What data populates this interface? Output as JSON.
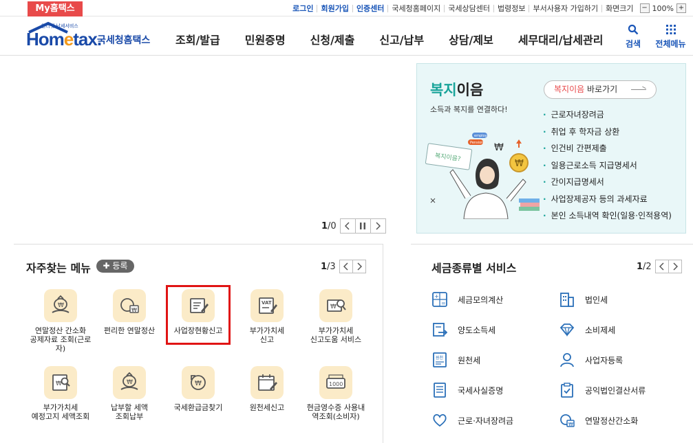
{
  "topbar": {
    "my_hometax": "My홈택스",
    "links": [
      {
        "label": "로그인",
        "blue": true
      },
      {
        "label": "회원가입",
        "blue": true
      },
      {
        "label": "인증센터",
        "blue": true
      },
      {
        "label": "국세청홈페이지",
        "blue": false
      },
      {
        "label": "국세상담센터",
        "blue": false
      },
      {
        "label": "법령정보",
        "blue": false
      },
      {
        "label": "부서사용자 가입하기",
        "blue": false
      },
      {
        "label": "화면크기",
        "blue": false
      }
    ],
    "zoom_minus": "−",
    "zoom_value": "100%",
    "zoom_plus": "+"
  },
  "header": {
    "logo_small": "인터넷 납세서비스",
    "logo_home": "Hom",
    "logo_e": "e",
    "logo_tax": "tax.",
    "logo_nts": "국세청홈택스",
    "nav": [
      "조회/발급",
      "민원증명",
      "신청/제출",
      "신고/납부",
      "상담/제보",
      "세무대리/납세관리"
    ],
    "search_label": "검색",
    "all_menu_label": "전체메뉴"
  },
  "banner": {
    "title_hl": "복지",
    "title_rest": "이음",
    "subtitle": "소득과 복지를 연결하다!",
    "go_hl": "복지이음",
    "go_rest": " 바로가기",
    "items": [
      "근로자녀장려금",
      "취업 후 학자금 상환",
      "인건비 간편제출",
      "일용근로소득 지급명세서",
      "간이지급명세서",
      "사업장제공자 등의 과세자료",
      "본인 소득내역 확인(일용·인적용역)"
    ],
    "illus_sign": "복지이음?",
    "illus_chip1": "employ",
    "illus_chip2": "Pension"
  },
  "banner_ctrl": {
    "current": "1",
    "total": "/0"
  },
  "freq": {
    "title": "자주찾는 메뉴",
    "add_label": "등록",
    "page_current": "1",
    "page_total": "/3",
    "items": [
      {
        "label": "연말정산 간소화\n공제자료 조회(근로\n자)",
        "icon": "bag-hand-icon"
      },
      {
        "label": "편리한 연말정산",
        "icon": "won-face-icon"
      },
      {
        "label": "사업장현황신고",
        "icon": "doc-pen-icon"
      },
      {
        "label": "부가가치세\n신고",
        "icon": "vat-doc-icon"
      },
      {
        "label": "부가가치세\n신고도움 서비스",
        "icon": "won-search-icon"
      },
      {
        "label": "부가가치세\n예정고지 세액조회",
        "icon": "won-doc-search-icon"
      },
      {
        "label": "납부할 세액\n조회납부",
        "icon": "bag-hand-icon"
      },
      {
        "label": "국세환급금찾기",
        "icon": "refund-coin-icon"
      },
      {
        "label": "원천세신고",
        "icon": "calendar-pen-icon"
      },
      {
        "label": "현금영수증 사용내\n역조회(소비자)",
        "icon": "receipt-1000-icon"
      }
    ]
  },
  "tax": {
    "title": "세금종류별 서비스",
    "page_current": "1",
    "page_total": "/2",
    "items": [
      {
        "label": "세금모의계산",
        "icon": "calculator-icon"
      },
      {
        "label": "법인세",
        "icon": "building-icon"
      },
      {
        "label": "양도소득세",
        "icon": "transfer-doc-icon"
      },
      {
        "label": "소비제세",
        "icon": "diamond-icon"
      },
      {
        "label": "원천세",
        "icon": "withholding-doc-icon"
      },
      {
        "label": "사업자등록",
        "icon": "person-icon"
      },
      {
        "label": "국세사실증명",
        "icon": "certificate-doc-icon"
      },
      {
        "label": "공익법인결산서류",
        "icon": "clipboard-check-icon"
      },
      {
        "label": "근로·자녀장려금",
        "icon": "heart-hand-icon"
      },
      {
        "label": "연말정산간소화",
        "icon": "won-chat-icon"
      }
    ]
  },
  "colors": {
    "accent": "#1a56b8",
    "brand_red": "#e84a4a",
    "tile": "#fbebc8",
    "teal": "#19a49a",
    "highlight": "#e01414"
  }
}
